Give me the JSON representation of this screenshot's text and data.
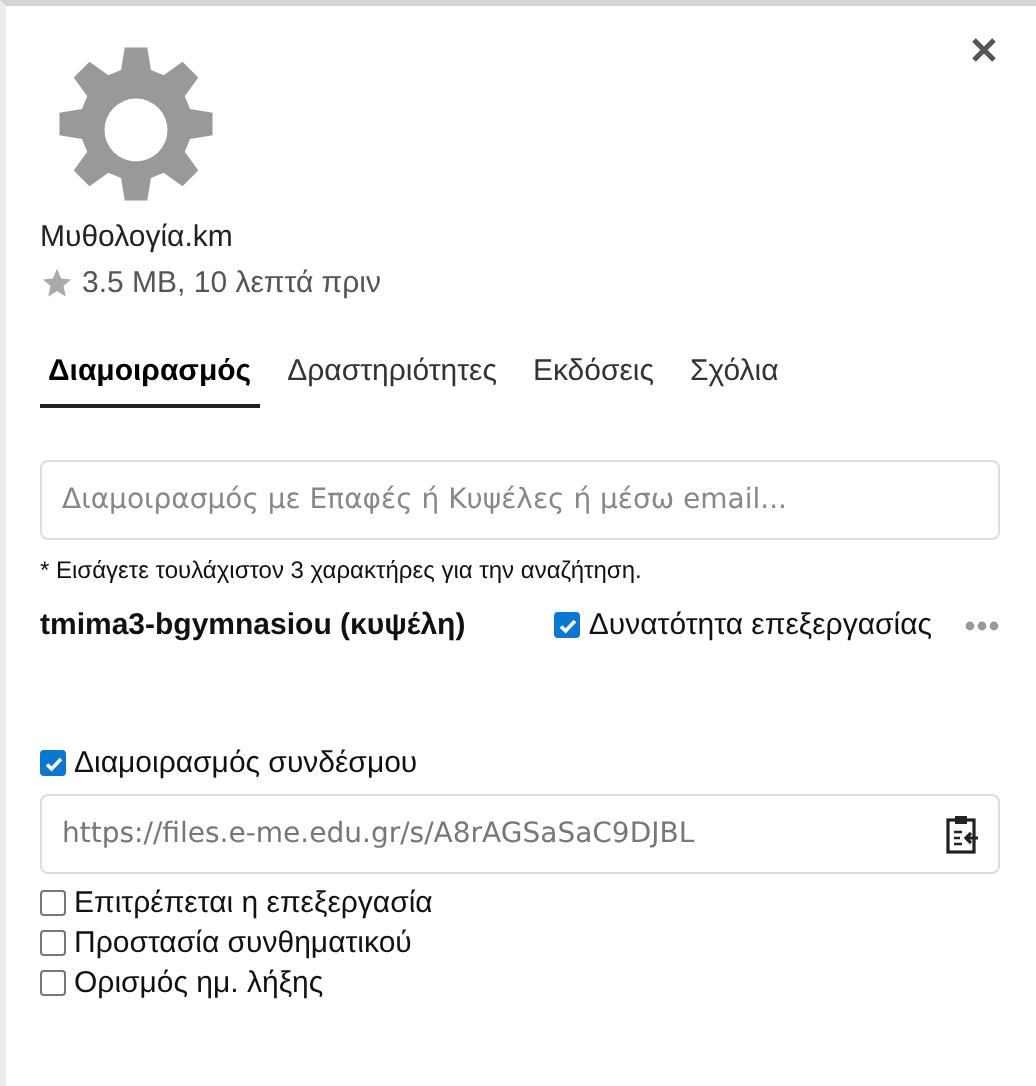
{
  "file": {
    "name": "Μυθολογία.km",
    "favorite": false,
    "meta": "3.5 MB, 10 λεπτά πριν"
  },
  "tabs": [
    {
      "label": "Διαμοιρασμός",
      "selected": true
    },
    {
      "label": "Δραστηριότητες",
      "selected": false
    },
    {
      "label": "Εκδόσεις",
      "selected": false
    },
    {
      "label": "Σχόλια",
      "selected": false
    }
  ],
  "search": {
    "placeholder": "Διαμοιρασμός με Επαφές ή Κυψέλες ή μέσω email..."
  },
  "hint": "* Εισάγετε τουλάχιστον 3 χαρακτήρες για την αναζήτηση.",
  "shares": [
    {
      "name": "tmima3-bgymnasiou (κυψέλη)",
      "permission": "Δυνατότητα επεξεργασίας",
      "checked": true
    }
  ],
  "link": {
    "label": "Διαμοιρασμός συνδέσμου",
    "checked": true,
    "url": "https://files.e-me.edu.gr/s/A8rAGSaSaC9DJBL"
  },
  "link_options": [
    {
      "label": "Επιτρέπεται η επεξεργασία",
      "checked": false
    },
    {
      "label": "Προστασία συνθηματικού",
      "checked": false
    },
    {
      "label": "Ορισμός ημ. λήξης",
      "checked": false
    }
  ]
}
